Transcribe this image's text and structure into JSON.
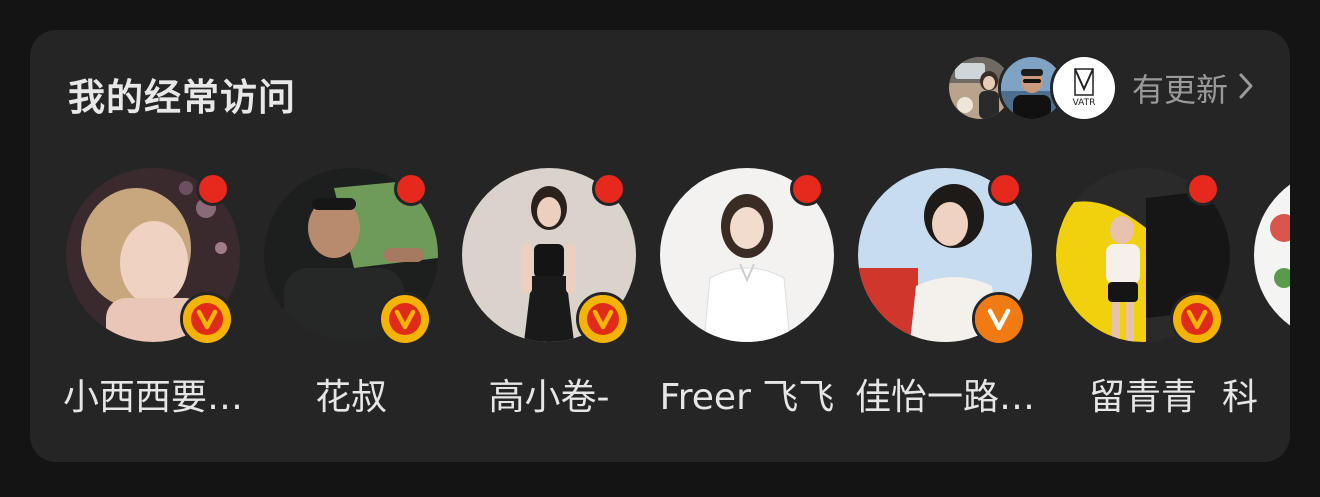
{
  "section": {
    "title": "我的经常访问",
    "update_text": "有更新",
    "update_avatar_icons": [
      "car-interior-avatar",
      "man-portrait-avatar",
      "vatr-logo-avatar"
    ],
    "vatr_logo_text": "VATR"
  },
  "users": [
    {
      "name": "小西西要…",
      "unread": true,
      "verified": "gold"
    },
    {
      "name": "花叔",
      "unread": true,
      "verified": "gold"
    },
    {
      "name": "高小卷-",
      "unread": true,
      "verified": "gold"
    },
    {
      "name": "Freer 飞飞",
      "unread": true,
      "verified": "none"
    },
    {
      "name": "佳怡一路…",
      "unread": true,
      "verified": "orange"
    },
    {
      "name": "留青青",
      "unread": true,
      "verified": "gold"
    },
    {
      "name": "科",
      "unread": false,
      "verified": "none"
    }
  ],
  "colors": {
    "card_bg": "#252525",
    "unread_dot": "#e6291c",
    "badge_gold": "#f5b400",
    "badge_orange": "#f07b12",
    "badge_red": "#e02b1a"
  }
}
